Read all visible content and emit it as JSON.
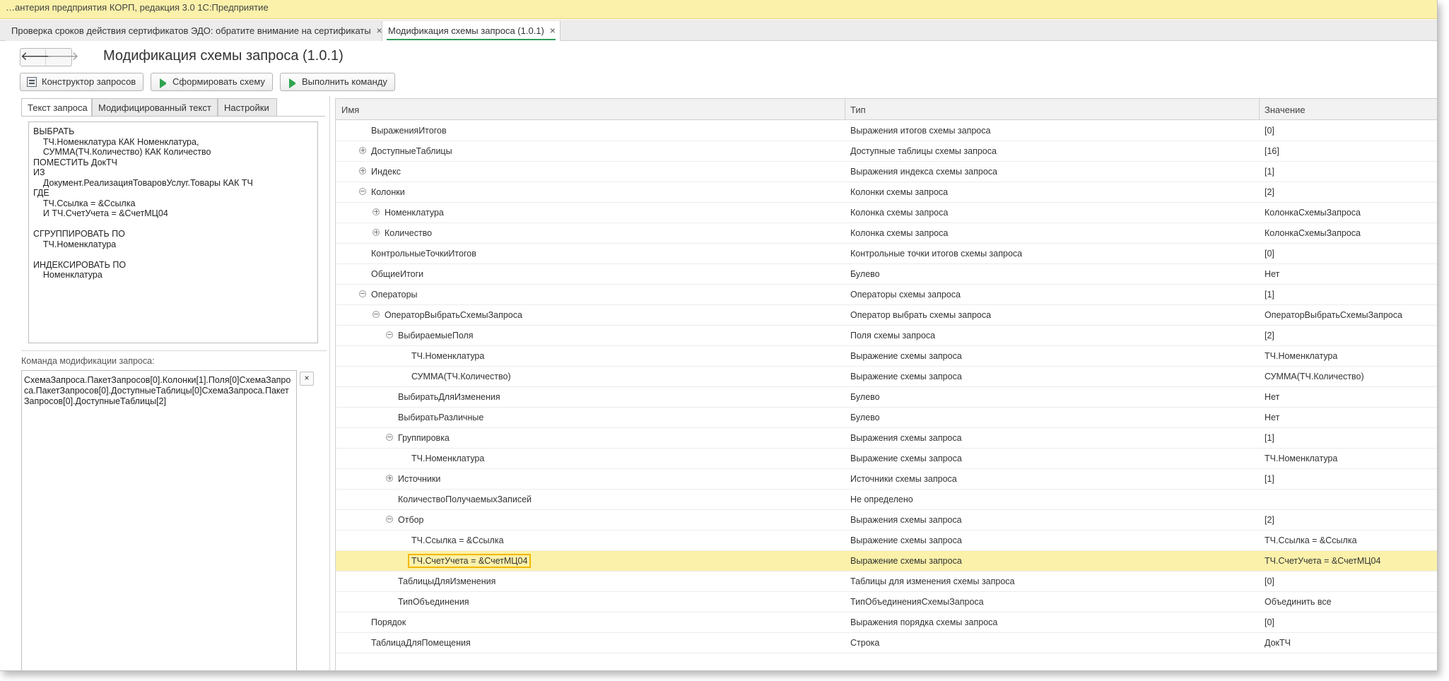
{
  "window": {
    "title": "…антерия предприятия КОРП, редакция 3.0 1С:Предприятие"
  },
  "doc_tabs": [
    {
      "label": "Проверка сроков действия сертификатов ЭДО: обратите внимание на сертификаты",
      "close": "×",
      "active": false
    },
    {
      "label": "Модификация схемы запроса (1.0.1)",
      "close": "×",
      "active": true
    }
  ],
  "nav": {
    "back_icon": "arrow-left-icon",
    "back": "🡐",
    "forward": "🡒",
    "forward_icon": "arrow-right-icon"
  },
  "form": {
    "title": "Модификация схемы запроса (1.0.1)"
  },
  "toolbar": {
    "constructor": "Конструктор запросов",
    "build_schema": "Сформировать схему",
    "run_command": "Выполнить команду",
    "play_color": "#2ea44f"
  },
  "query_tabs": [
    {
      "label": "Текст запроса",
      "active": true
    },
    {
      "label": "Модифицированный текст",
      "active": false
    },
    {
      "label": "Настройки",
      "active": false
    }
  ],
  "query_text": "ВЫБРАТЬ\n    ТЧ.Номенклатура КАК Номенклатура,\n    СУММА(ТЧ.Количество) КАК Количество\nПОМЕСТИТЬ ДокТЧ\nИЗ\n    Документ.РеализацияТоваровУслуг.Товары КАК ТЧ\nГДЕ\n    ТЧ.Ссылка = &Ссылка\n    И ТЧ.СчетУчета = &СчетМЦ04\n\nСГРУППИРОВАТЬ ПО\n    ТЧ.Номенклатура\n\nИНДЕКСИРОВАТЬ ПО\n    Номенклатура",
  "command": {
    "label": "Команда модификации запроса:",
    "text": "СхемаЗапроса.ПакетЗапросов[0].Колонки[1].Поля[0]СхемаЗапроса.ПакетЗапросов[0].ДоступныеТаблицы[0]СхемаЗапроса.ПакетЗапросов[0].ДоступныеТаблицы[2]",
    "clear": "×"
  },
  "tree": {
    "columns": [
      "Имя",
      "Тип",
      "Значение"
    ],
    "selected_color": "#fbf1aa",
    "rows": [
      {
        "name": "ВыраженияИтогов",
        "type": "Выражения итогов схемы запроса",
        "value": "[0]",
        "level": 0,
        "expander": ""
      },
      {
        "name": "ДоступныеТаблицы",
        "type": "Доступные таблицы схемы запроса",
        "value": "[16]",
        "level": 0,
        "expander": "plus"
      },
      {
        "name": "Индекс",
        "type": "Выражения индекса схемы запроса",
        "value": "[1]",
        "level": 0,
        "expander": "plus"
      },
      {
        "name": "Колонки",
        "type": "Колонки схемы запроса",
        "value": "[2]",
        "level": 0,
        "expander": "minus"
      },
      {
        "name": "Номенклатура",
        "type": "Колонка схемы запроса",
        "value": "КолонкаСхемыЗапроса",
        "level": 1,
        "expander": "plus"
      },
      {
        "name": "Количество",
        "type": "Колонка схемы запроса",
        "value": "КолонкаСхемыЗапроса",
        "level": 1,
        "expander": "plus"
      },
      {
        "name": "КонтрольныеТочкиИтогов",
        "type": "Контрольные точки итогов схемы запроса",
        "value": "[0]",
        "level": 0,
        "expander": ""
      },
      {
        "name": "ОбщиеИтоги",
        "type": "Булево",
        "value": "Нет",
        "level": 0,
        "expander": ""
      },
      {
        "name": "Операторы",
        "type": "Операторы схемы запроса",
        "value": "[1]",
        "level": 0,
        "expander": "minus"
      },
      {
        "name": "ОператорВыбратьСхемыЗапроса",
        "type": "Оператор выбрать схемы запроса",
        "value": "ОператорВыбратьСхемыЗапроса",
        "level": 1,
        "expander": "minus"
      },
      {
        "name": "ВыбираемыеПоля",
        "type": "Поля схемы запроса",
        "value": "[2]",
        "level": 2,
        "expander": "minus"
      },
      {
        "name": "ТЧ.Номенклатура",
        "type": "Выражение схемы запроса",
        "value": "ТЧ.Номенклатура",
        "level": 3,
        "expander": ""
      },
      {
        "name": "СУММА(ТЧ.Количество)",
        "type": "Выражение схемы запроса",
        "value": "СУММА(ТЧ.Количество)",
        "level": 3,
        "expander": ""
      },
      {
        "name": "ВыбиратьДляИзменения",
        "type": "Булево",
        "value": "Нет",
        "level": 2,
        "expander": ""
      },
      {
        "name": "ВыбиратьРазличные",
        "type": "Булево",
        "value": "Нет",
        "level": 2,
        "expander": ""
      },
      {
        "name": "Группировка",
        "type": "Выражения схемы запроса",
        "value": "[1]",
        "level": 2,
        "expander": "minus"
      },
      {
        "name": "ТЧ.Номенклатура",
        "type": "Выражение схемы запроса",
        "value": "ТЧ.Номенклатура",
        "level": 3,
        "expander": ""
      },
      {
        "name": "Источники",
        "type": "Источники схемы запроса",
        "value": "[1]",
        "level": 2,
        "expander": "plus"
      },
      {
        "name": "КоличествоПолучаемыхЗаписей",
        "type": "Не определено",
        "value": "",
        "level": 2,
        "expander": ""
      },
      {
        "name": "Отбор",
        "type": "Выражения схемы запроса",
        "value": "[2]",
        "level": 2,
        "expander": "minus"
      },
      {
        "name": "ТЧ.Ссылка = &Ссылка",
        "type": "Выражение схемы запроса",
        "value": "ТЧ.Ссылка = &Ссылка",
        "level": 3,
        "expander": ""
      },
      {
        "name": "ТЧ.СчетУчета = &СчетМЦ04",
        "type": "Выражение схемы запроса",
        "value": "ТЧ.СчетУчета = &СчетМЦ04",
        "level": 3,
        "expander": "",
        "selected": true
      },
      {
        "name": "ТаблицыДляИзменения",
        "type": "Таблицы для изменения схемы запроса",
        "value": "[0]",
        "level": 2,
        "expander": ""
      },
      {
        "name": "ТипОбъединения",
        "type": "ТипОбъединенияСхемыЗапроса",
        "value": "Объединить все",
        "level": 2,
        "expander": ""
      },
      {
        "name": "Порядок",
        "type": "Выражения порядка схемы запроса",
        "value": "[0]",
        "level": 0,
        "expander": ""
      },
      {
        "name": "ТаблицаДляПомещения",
        "type": "Строка",
        "value": "ДокТЧ",
        "level": 0,
        "expander": ""
      }
    ]
  }
}
